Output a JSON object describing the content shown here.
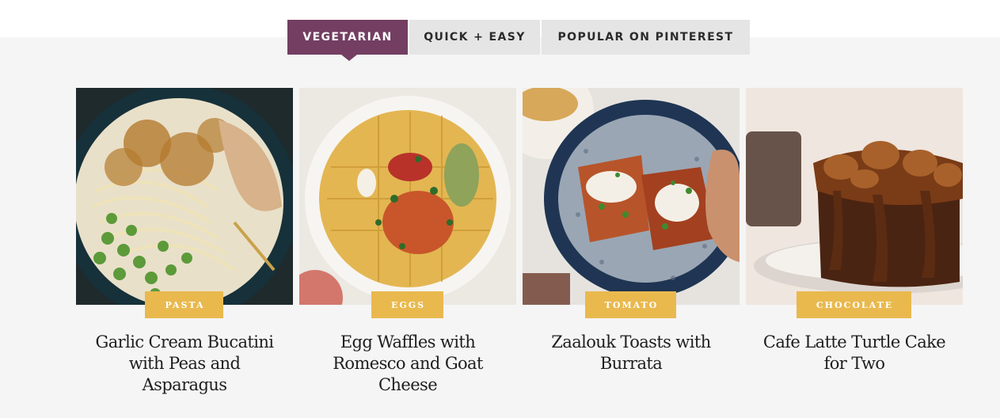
{
  "tabs": [
    {
      "label": "VEGETARIAN",
      "active": true
    },
    {
      "label": "QUICK + EASY",
      "active": false
    },
    {
      "label": "POPULAR ON PINTEREST",
      "active": false
    }
  ],
  "cards": [
    {
      "category": "PASTA",
      "title_lines": [
        "Garlic Cream Bucatini",
        "with Peas and",
        "Asparagus"
      ]
    },
    {
      "category": "EGGS",
      "title_lines": [
        "Egg Waffles with",
        "Romesco and Goat",
        "Cheese"
      ]
    },
    {
      "category": "TOMATO",
      "title_lines": [
        "Zaalouk Toasts with",
        "Burrata"
      ]
    },
    {
      "category": "CHOCOLATE",
      "title_lines": [
        "Cafe Latte Turtle Cake",
        "for Two"
      ]
    }
  ],
  "colors": {
    "active_tab": "#733e61",
    "badge": "#e9b94e",
    "panel_bg": "#f5f5f5"
  }
}
